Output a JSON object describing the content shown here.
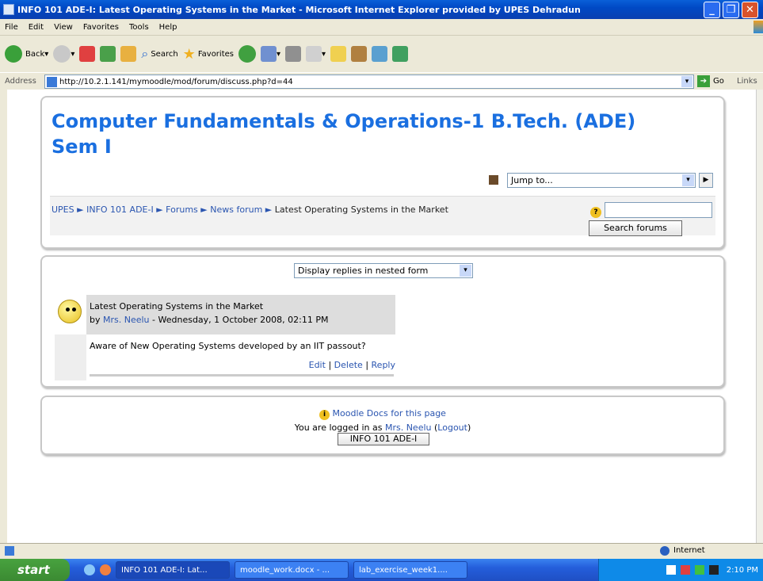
{
  "window": {
    "title": "INFO 101 ADE-I: Latest Operating Systems in the Market - Microsoft Internet Explorer provided by UPES Dehradun"
  },
  "menu": [
    "File",
    "Edit",
    "View",
    "Favorites",
    "Tools",
    "Help"
  ],
  "toolbar": {
    "back": "Back",
    "search": "Search",
    "favorites": "Favorites"
  },
  "address": {
    "label": "Address",
    "url": "http://10.2.1.141/mymoodle/mod/forum/discuss.php?d=44",
    "go": "Go",
    "links": "Links"
  },
  "page": {
    "course_title": "Computer Fundamentals & Operations-1 B.Tech. (ADE) Sem I",
    "jump_to": "Jump to...",
    "breadcrumb": {
      "b1": "UPES",
      "b2": "INFO 101 ADE-I",
      "b3": "Forums",
      "b4": "News forum",
      "current": "Latest Operating Systems in the Market",
      "sep": "►"
    },
    "search_button": "Search forums",
    "display_mode": "Display replies in nested form",
    "post": {
      "subject": "Latest Operating Systems in the Market",
      "by": "by",
      "author": "Mrs. Neelu",
      "date": " - Wednesday, 1 October 2008, 02:11 PM",
      "message": "Aware of New Operating Systems developed by an IIT passout?",
      "edit": "Edit",
      "delete": "Delete",
      "reply": "Reply",
      "sep": "|"
    },
    "footer": {
      "docs": "Moodle Docs for this page",
      "logged_pre": "You are logged in as",
      "user": "Mrs. Neelu",
      "logout": "Logout",
      "course_button": "INFO 101 ADE-I"
    }
  },
  "status": {
    "zone": "Internet"
  },
  "taskbar": {
    "start": "start",
    "tasks": [
      "INFO 101 ADE-I: Lat...",
      "moodle_work.docx - ...",
      "lab_exercise_week1...."
    ],
    "clock": "2:10 PM"
  }
}
